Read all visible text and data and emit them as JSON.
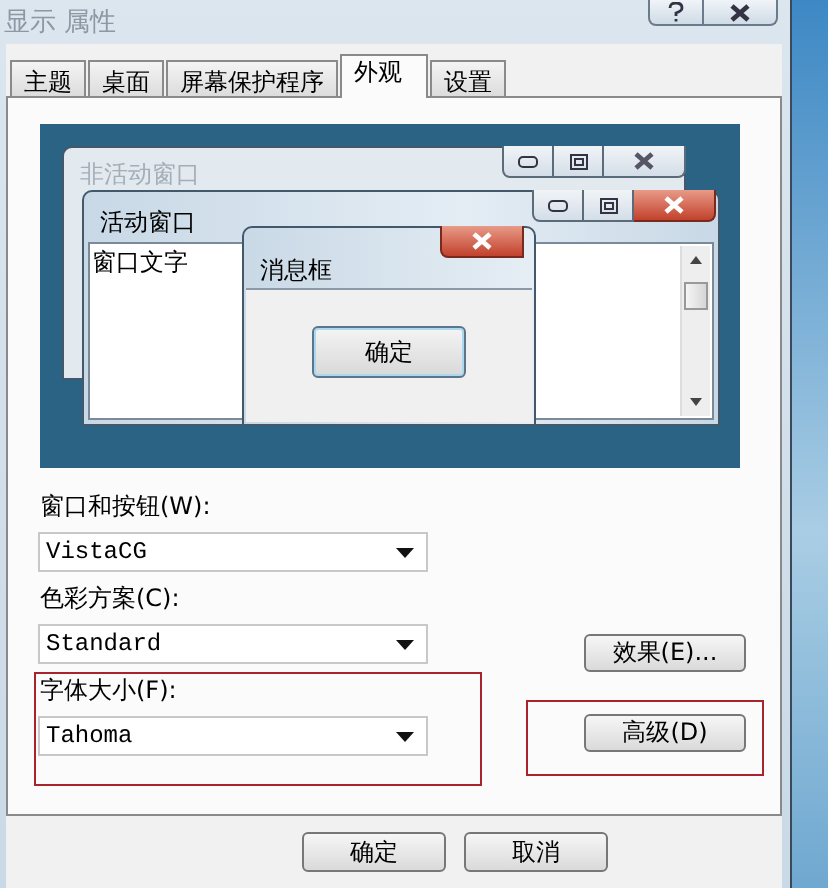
{
  "window": {
    "title": "显示 属性"
  },
  "tabs": [
    {
      "label": "主题",
      "selected": false
    },
    {
      "label": "桌面",
      "selected": false
    },
    {
      "label": "屏幕保护程序",
      "selected": false
    },
    {
      "label": "外观",
      "selected": true
    },
    {
      "label": "设置",
      "selected": false
    }
  ],
  "preview": {
    "inactive_window": {
      "title": "非活动窗口"
    },
    "active_window": {
      "title": "活动窗口",
      "text": "窗口文字"
    },
    "message_box": {
      "title": "消息框",
      "button": "确定"
    }
  },
  "fields": [
    {
      "label": "窗口和按钮(W):",
      "value": "VistaCG",
      "highlighted": false
    },
    {
      "label": "色彩方案(C):",
      "value": "Standard",
      "highlighted": false
    },
    {
      "label": "字体大小(F):",
      "value": "Tahoma",
      "highlighted": true
    }
  ],
  "side_buttons": [
    {
      "label": "效果(E)...",
      "highlighted": false
    },
    {
      "label": "高级(D)",
      "highlighted": true
    }
  ],
  "buttons": [
    "确定",
    "取消"
  ]
}
